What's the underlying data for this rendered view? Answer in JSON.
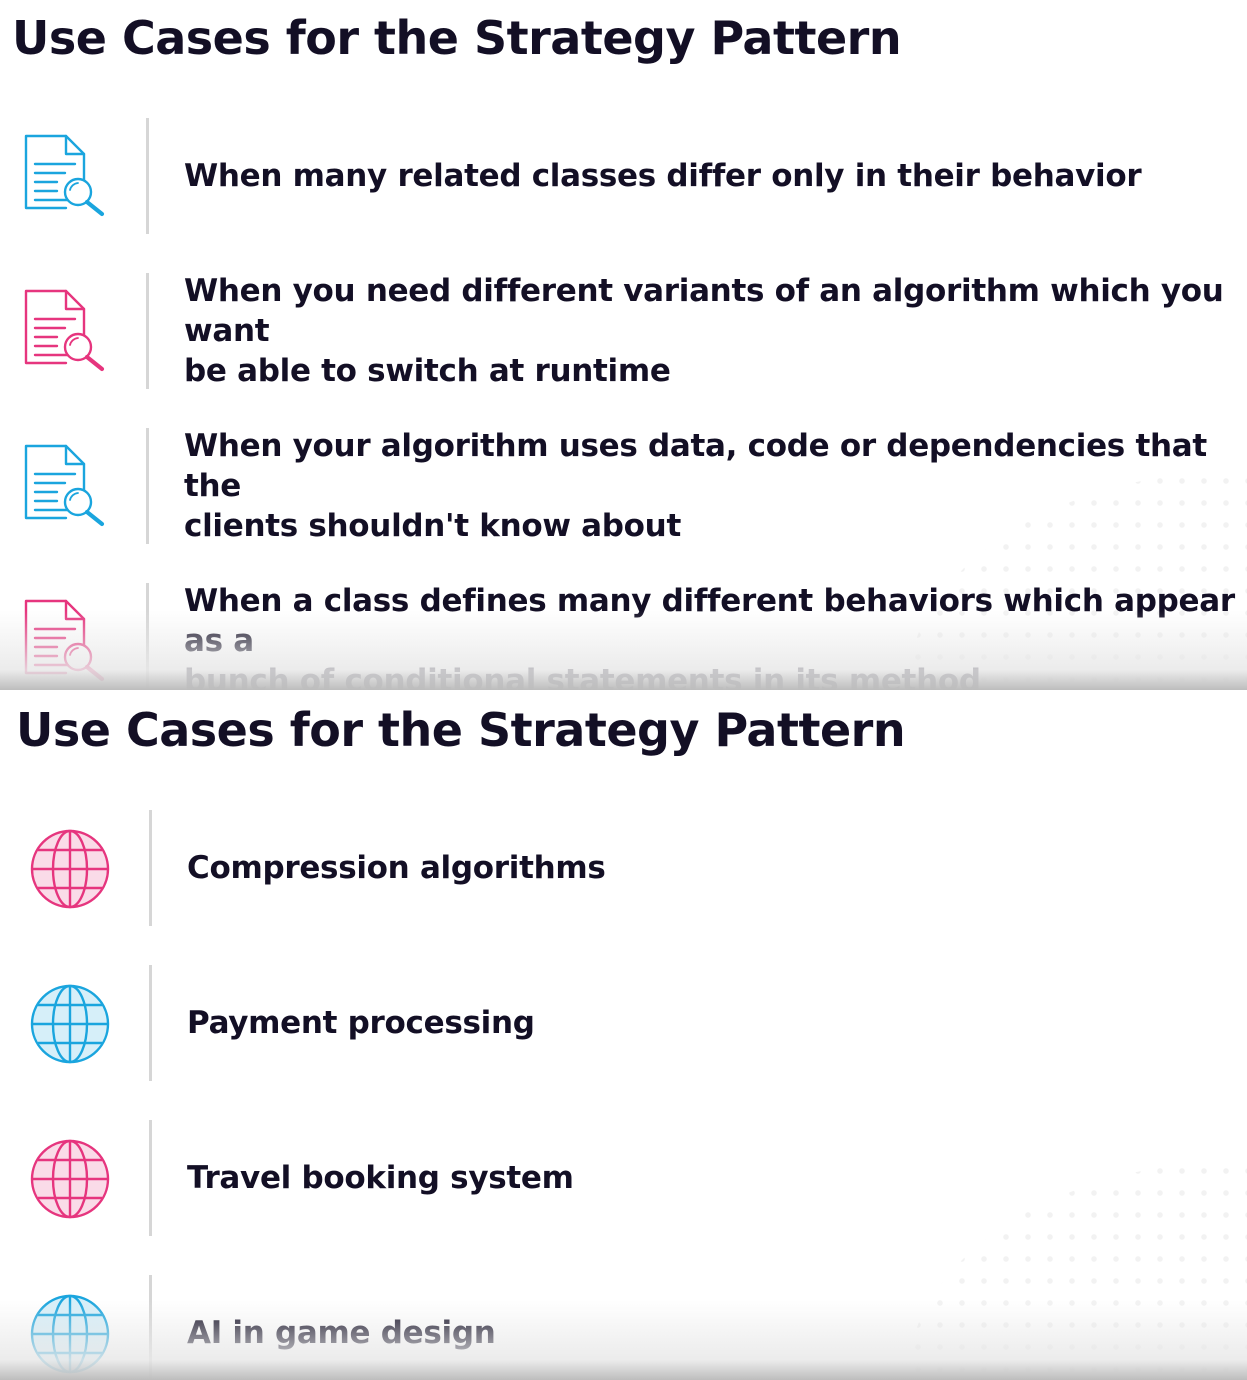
{
  "colors": {
    "blue": "#1aa5de",
    "pink": "#e6357e",
    "text": "#130f25",
    "divider": "#d6d6d6"
  },
  "slide1": {
    "title": "Use Cases for the Strategy Pattern",
    "items": [
      {
        "icon": "document-search-icon",
        "color": "blue",
        "lines": [
          "When many related classes differ only in their behavior"
        ]
      },
      {
        "icon": "document-search-icon",
        "color": "pink",
        "lines": [
          "When you need different variants of an algorithm which you want",
          "be able to switch at runtime"
        ]
      },
      {
        "icon": "document-search-icon",
        "color": "blue",
        "lines": [
          "When your algorithm uses data, code or dependencies that the",
          "clients shouldn't know about"
        ]
      },
      {
        "icon": "document-search-icon",
        "color": "pink",
        "lines": [
          "When a class defines many different behaviors which appear as a",
          "bunch of conditional statements in its method"
        ]
      }
    ]
  },
  "slide2": {
    "title": "Use Cases for the Strategy Pattern",
    "items": [
      {
        "icon": "globe-icon",
        "color": "pink",
        "lines": [
          "Compression algorithms"
        ]
      },
      {
        "icon": "globe-icon",
        "color": "blue",
        "lines": [
          "Payment processing"
        ]
      },
      {
        "icon": "globe-icon",
        "color": "pink",
        "lines": [
          "Travel booking system"
        ]
      },
      {
        "icon": "globe-icon",
        "color": "blue",
        "lines": [
          "AI in game design"
        ]
      }
    ]
  }
}
